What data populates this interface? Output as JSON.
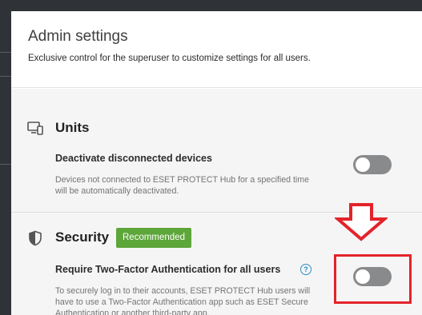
{
  "dialog": {
    "title": "Admin settings",
    "subtitle": "Exclusive control for the superuser to customize settings for all users."
  },
  "units": {
    "icon": "monitor-devices-icon",
    "title": "Units",
    "setting_label": "Deactivate disconnected devices",
    "setting_desc": "Devices not connected to ESET PROTECT Hub for a specified time will be automatically deactivated.",
    "toggle_on": false
  },
  "security": {
    "icon": "shield-icon",
    "title": "Security",
    "badge": "Recommended",
    "setting_label": "Require Two-Factor Authentication for all users",
    "help_glyph": "?",
    "setting_desc": "To securely log in to their accounts, ESET PROTECT Hub users will have to use a Two-Factor Authentication app such as ESET Secure Authentication or another third-party app.",
    "toggle_on": false
  },
  "colors": {
    "badge": "#5da63a",
    "highlight": "#e3232a",
    "toggle_off": "#888a8c",
    "help_icon": "#2a8cc7"
  },
  "annotation": {
    "icon": "down-arrow-icon"
  }
}
